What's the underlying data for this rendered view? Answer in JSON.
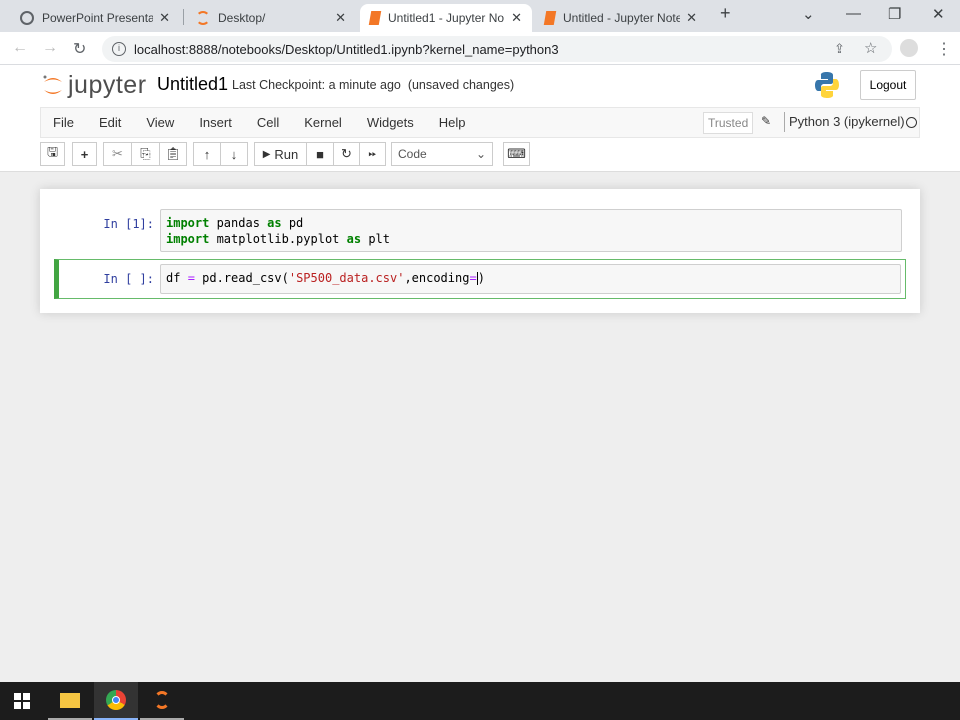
{
  "browser": {
    "tabs": [
      {
        "label": "PowerPoint Presentati",
        "icon": "globe-icon"
      },
      {
        "label": "Desktop/",
        "icon": "jupyter-icon"
      },
      {
        "label": "Untitled1 - Jupyter No",
        "icon": "notebook-icon",
        "active": true
      },
      {
        "label": "Untitled - Jupyter Note",
        "icon": "notebook-icon"
      }
    ],
    "url": "localhost:8888/notebooks/Desktop/Untitled1.ipynb?kernel_name=python3"
  },
  "header": {
    "logo_text": "jupyter",
    "notebook_name": "Untitled1",
    "checkpoint": "Last Checkpoint: a minute ago",
    "status": "(unsaved changes)",
    "logout_label": "Logout"
  },
  "menubar": {
    "items": [
      "File",
      "Edit",
      "View",
      "Insert",
      "Cell",
      "Kernel",
      "Widgets",
      "Help"
    ],
    "trusted": "Trusted",
    "kernel": "Python 3 (ipykernel)"
  },
  "toolbar": {
    "run_label": "Run",
    "cell_type": "Code"
  },
  "cells": [
    {
      "prompt": "In [1]:",
      "lines": [
        [
          {
            "t": "import",
            "c": "kw"
          },
          {
            "t": " pandas "
          },
          {
            "t": "as",
            "c": "kw"
          },
          {
            "t": " pd"
          }
        ],
        [
          {
            "t": "import",
            "c": "kw"
          },
          {
            "t": " matplotlib.pyplot "
          },
          {
            "t": "as",
            "c": "kw"
          },
          {
            "t": " plt"
          }
        ]
      ]
    },
    {
      "prompt": "In [ ]:",
      "selected": true,
      "lines": [
        [
          {
            "t": "df "
          },
          {
            "t": "=",
            "c": "op"
          },
          {
            "t": " pd.read_csv("
          },
          {
            "t": "'SP500_data.csv'",
            "c": "str"
          },
          {
            "t": ",encoding"
          },
          {
            "t": "=",
            "c": "op"
          },
          {
            "t": "|"
          },
          {
            "t": ")"
          }
        ]
      ]
    }
  ]
}
